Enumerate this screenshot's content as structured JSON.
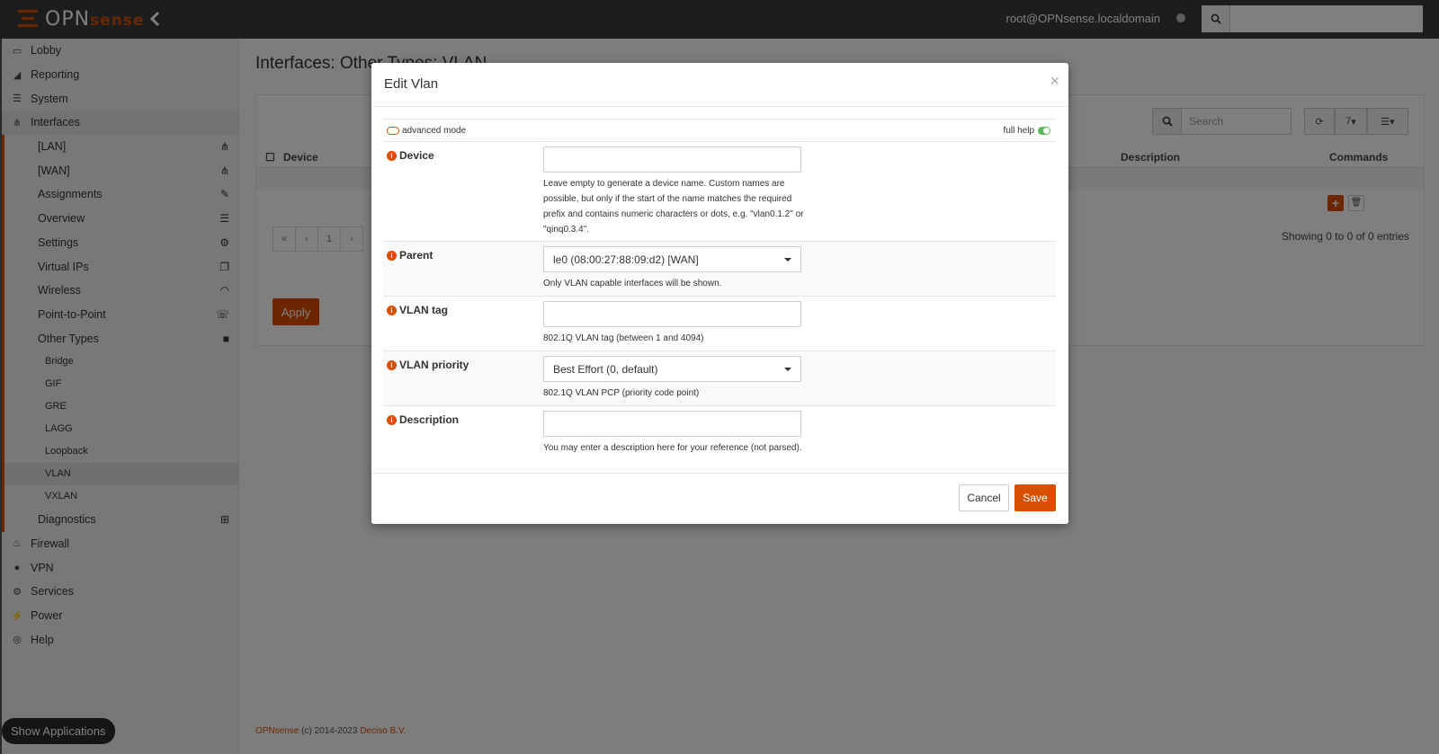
{
  "topbar": {
    "logo_main": "OPN",
    "logo_sub": "sense",
    "user": "root@OPNsense.localdomain",
    "search_placeholder": ""
  },
  "sidebar": {
    "items": [
      {
        "label": "Lobby",
        "icon": "laptop-icon",
        "level": 0
      },
      {
        "label": "Reporting",
        "icon": "area-chart-icon",
        "level": 0
      },
      {
        "label": "System",
        "icon": "server-icon",
        "level": 0
      },
      {
        "label": "Interfaces",
        "icon": "sitemap-icon",
        "level": 0
      },
      {
        "label": "[LAN]",
        "icon": "sitemap-icon",
        "level": 1
      },
      {
        "label": "[WAN]",
        "icon": "sitemap-icon",
        "level": 1
      },
      {
        "label": "Assignments",
        "icon": "pencil-icon",
        "level": 1
      },
      {
        "label": "Overview",
        "icon": "tasks-icon",
        "level": 1
      },
      {
        "label": "Settings",
        "icon": "cogs-icon",
        "level": 1
      },
      {
        "label": "Virtual IPs",
        "icon": "clone-icon",
        "level": 1
      },
      {
        "label": "Wireless",
        "icon": "wifi-icon",
        "level": 1
      },
      {
        "label": "Point-to-Point",
        "icon": "tty-icon",
        "level": 1
      },
      {
        "label": "Other Types",
        "icon": "archive-icon",
        "level": 1
      },
      {
        "label": "Bridge",
        "level": 2
      },
      {
        "label": "GIF",
        "level": 2
      },
      {
        "label": "GRE",
        "level": 2
      },
      {
        "label": "LAGG",
        "level": 2
      },
      {
        "label": "Loopback",
        "level": 2
      },
      {
        "label": "VLAN",
        "level": 2,
        "active": true
      },
      {
        "label": "VXLAN",
        "level": 2
      },
      {
        "label": "Diagnostics",
        "icon": "medkit-icon",
        "level": 1
      },
      {
        "label": "Firewall",
        "icon": "fire-icon",
        "level": 0
      },
      {
        "label": "VPN",
        "icon": "globe-icon",
        "level": 0
      },
      {
        "label": "Services",
        "icon": "cog-icon",
        "level": 0
      },
      {
        "label": "Power",
        "icon": "plug-icon",
        "level": 0
      },
      {
        "label": "Help",
        "icon": "life-ring-icon",
        "level": 0
      }
    ],
    "show_applications": "Show Applications"
  },
  "main": {
    "page_title": "Interfaces: Other Types: VLAN",
    "search_placeholder": "Search",
    "rows_per_page": "7",
    "columns": {
      "device": "Device",
      "description": "Description",
      "commands": "Commands"
    },
    "pager": [
      "«",
      "‹",
      "1",
      "›"
    ],
    "showing": "Showing 0 to 0 of 0 entries",
    "apply": "Apply",
    "footer": {
      "brand": "OPNsense",
      "copyright": " (c) 2014-2023 ",
      "company": "Deciso B.V."
    }
  },
  "modal": {
    "title": "Edit Vlan",
    "close": "×",
    "advanced_mode": "advanced mode",
    "full_help": "full help",
    "fields": {
      "device": {
        "label": "Device",
        "value": "",
        "help": "Leave empty to generate a device name. Custom names are possible, but only if the start of the name matches the required prefix and contains numeric characters or dots, e.g. \"vlan0.1.2\" or \"qinq0.3.4\"."
      },
      "parent": {
        "label": "Parent",
        "value": "le0 (08:00:27:88:09:d2) [WAN]",
        "help": "Only VLAN capable interfaces will be shown."
      },
      "vlan_tag": {
        "label": "VLAN tag",
        "value": "",
        "help": "802.1Q VLAN tag (between 1 and 4094)"
      },
      "vlan_priority": {
        "label": "VLAN priority",
        "value": "Best Effort (0, default)",
        "help": "802.1Q VLAN PCP (priority code point)"
      },
      "description": {
        "label": "Description",
        "value": "",
        "help": "You may enter a description here for your reference (not parsed)."
      }
    },
    "cancel": "Cancel",
    "save": "Save"
  },
  "colors": {
    "accent": "#d94f00",
    "topbar": "#3a3a3a",
    "toggle_on": "#5cb85c"
  }
}
